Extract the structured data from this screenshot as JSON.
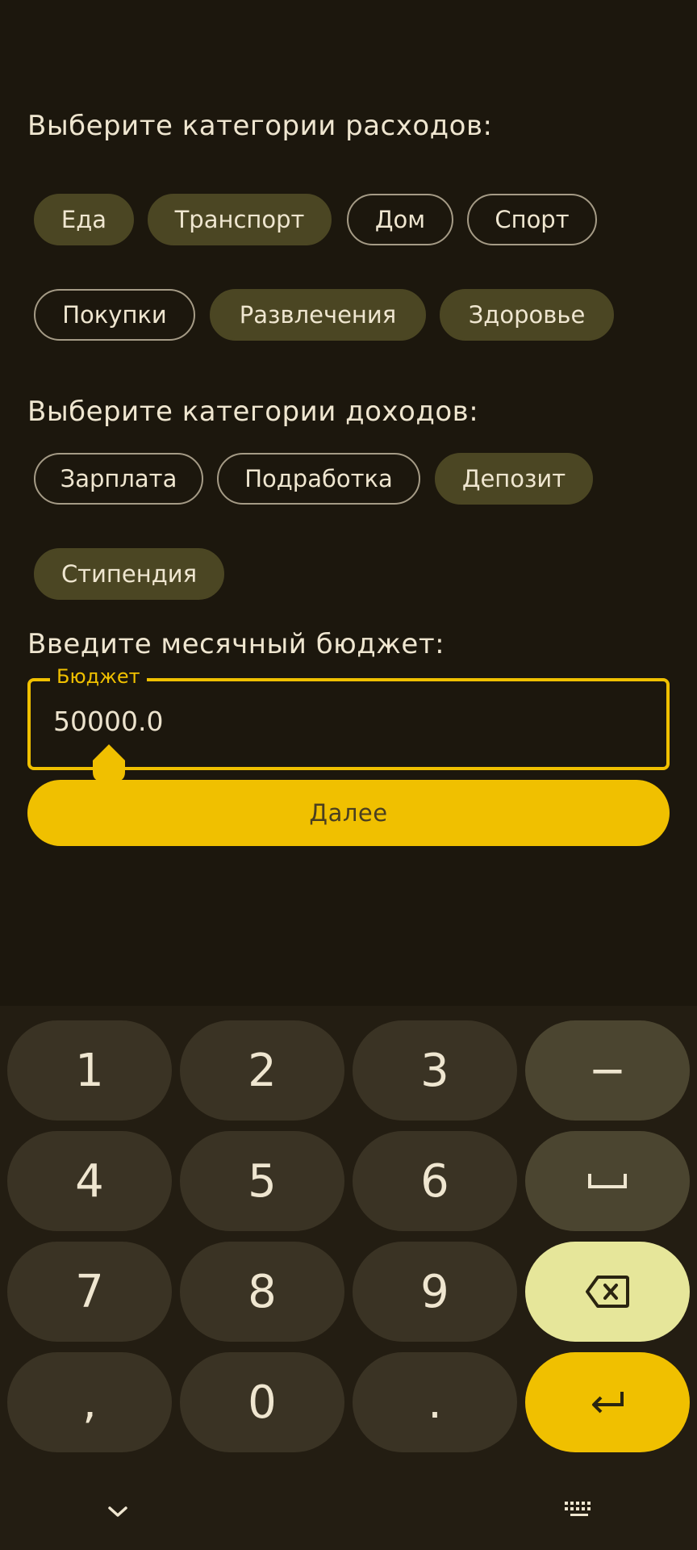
{
  "expenses": {
    "title": "Выберите категории расходов:",
    "chips": [
      {
        "label": "Еда",
        "selected": true
      },
      {
        "label": "Транспорт",
        "selected": true
      },
      {
        "label": "Дом",
        "selected": false
      },
      {
        "label": "Спорт",
        "selected": false
      },
      {
        "label": "Покупки",
        "selected": false
      },
      {
        "label": "Развлечения",
        "selected": true
      },
      {
        "label": "Здоровье",
        "selected": true
      }
    ]
  },
  "incomes": {
    "title": "Выберите категории доходов:",
    "chips": [
      {
        "label": "Зарплата",
        "selected": false
      },
      {
        "label": "Подработка",
        "selected": false
      },
      {
        "label": "Депозит",
        "selected": true
      },
      {
        "label": "Стипендия",
        "selected": true
      }
    ]
  },
  "budget": {
    "title": "Введите месячный бюджет:",
    "field_label": "Бюджет",
    "value": "50000.0"
  },
  "next_button": {
    "label": "Далее"
  },
  "keyboard": {
    "keys": [
      "1",
      "2",
      "3",
      "−",
      "4",
      "5",
      "6",
      "7",
      "8",
      "9",
      ",",
      "0",
      "."
    ],
    "space_icon": "space-icon",
    "backspace_icon": "backspace-icon",
    "enter_icon": "enter-icon"
  },
  "navbar": {
    "hide_keyboard_icon": "chevron-down-icon",
    "keyboard_switch_icon": "keyboard-icon"
  },
  "colors": {
    "background": "#1c170d",
    "accent": "#f0c000",
    "chip_selected": "#4b4623",
    "backspace_key": "#e6e69a"
  }
}
